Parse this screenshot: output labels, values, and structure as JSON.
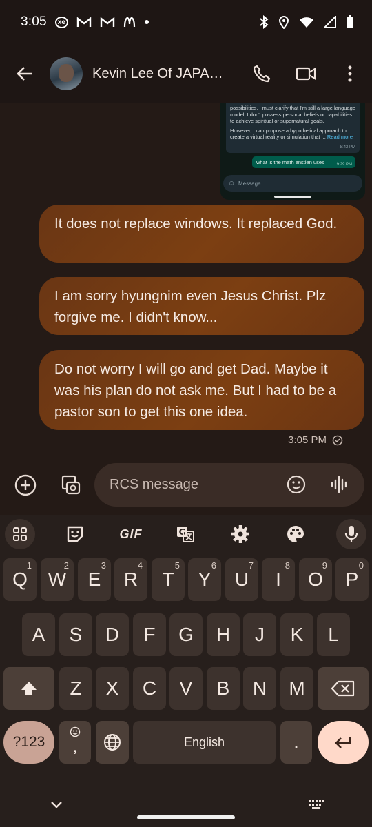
{
  "status_bar": {
    "time": "3:05",
    "left_icons": [
      "xe-icon",
      "gmail-icon",
      "gmail-icon",
      "mcdonalds-icon",
      "dot-icon"
    ],
    "xe_label": "xe",
    "right_icons": [
      "bluetooth-icon",
      "location-icon",
      "wifi-icon",
      "signal-icon",
      "battery-icon"
    ]
  },
  "app_bar": {
    "contact_name": "Kevin Lee Of JAPAN...",
    "actions": [
      "phone-icon",
      "video-call-icon",
      "more-vert-icon"
    ]
  },
  "screenshot_attachment": {
    "received_text": "possibilities, I must clarify that I'm still a large language model, I don't possess personal beliefs or capabilities to achieve spiritual or supernatural goals.",
    "received_text_2": "However, I can propose a hypothetical approach to create a virtual reality or simulation that ...",
    "read_more": "Read more",
    "received_time": "8:42 PM",
    "sent_text": "what is the math enstien uses",
    "sent_time": "9:29 PM",
    "input_placeholder": "Message"
  },
  "messages": [
    {
      "text": "It does not replace windows. It replaced God."
    },
    {
      "text": "I am sorry hyungnim even Jesus Christ. Plz forgive me. I didn't know..."
    },
    {
      "text": "Do not worry I will go and get Dad. Maybe it was his plan do not ask me. But I had to be a pastor son to get this one idea."
    }
  ],
  "message_time": "3:05 PM",
  "compose": {
    "placeholder": "RCS message"
  },
  "keyboard": {
    "toolbar": [
      "apps-grid-icon",
      "sticker-icon",
      "gif",
      "translate-icon",
      "settings-icon",
      "palette-icon",
      "mic-icon"
    ],
    "gif_label": "GIF",
    "row1": [
      {
        "k": "Q",
        "n": "1"
      },
      {
        "k": "W",
        "n": "2"
      },
      {
        "k": "E",
        "n": "3"
      },
      {
        "k": "R",
        "n": "4"
      },
      {
        "k": "T",
        "n": "5"
      },
      {
        "k": "Y",
        "n": "6"
      },
      {
        "k": "U",
        "n": "7"
      },
      {
        "k": "I",
        "n": "8"
      },
      {
        "k": "O",
        "n": "9"
      },
      {
        "k": "P",
        "n": "0"
      }
    ],
    "row2": [
      "A",
      "S",
      "D",
      "F",
      "G",
      "H",
      "J",
      "K",
      "L"
    ],
    "row3": [
      "Z",
      "X",
      "C",
      "V",
      "B",
      "N",
      "M"
    ],
    "symbols_label": "?123",
    "comma_label": ",",
    "space_label": "English",
    "period_label": "."
  },
  "colors": {
    "bubble": "#7c3f12",
    "background": "#241a16",
    "keyboard": "#271f1c",
    "enter_key": "#ffd9c9"
  }
}
